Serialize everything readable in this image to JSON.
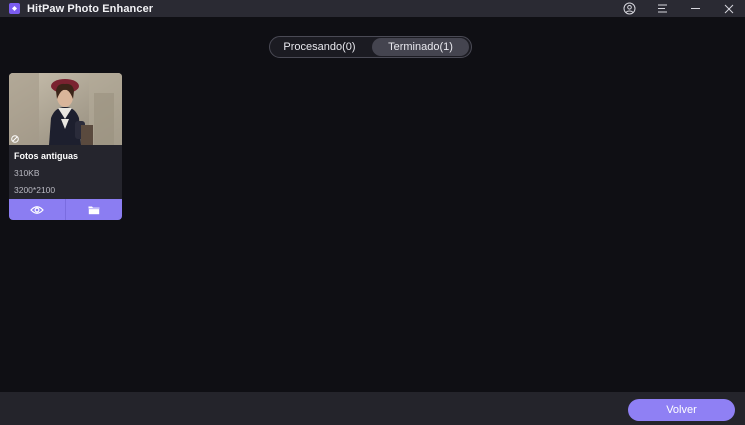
{
  "window": {
    "title": "HitPaw Photo Enhancer",
    "icons": [
      "logo-icon",
      "account-icon",
      "menu-icon",
      "minimize-icon",
      "close-icon"
    ]
  },
  "tabs": [
    {
      "label": "Procesando(0)",
      "active": false
    },
    {
      "label": "Terminado(1)",
      "active": true
    }
  ],
  "cards": [
    {
      "name": "Fotos antiguas",
      "size": "310KB",
      "dimensions": "3200*2100",
      "actions": [
        "preview-eye-icon",
        "open-folder-icon"
      ]
    }
  ],
  "footer": {
    "back_label": "Volver"
  },
  "colors": {
    "accent": "#8f80f4",
    "background": "#0f0f14",
    "titlebar": "#2a2a33",
    "card": "#25252d"
  }
}
